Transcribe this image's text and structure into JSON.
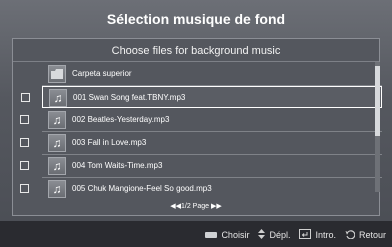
{
  "window": {
    "title": "Sélection musique de fond"
  },
  "panel": {
    "subtitle": "Choose files for background music",
    "folder_item": {
      "label": "Carpeta superior",
      "icon": "folder-icon"
    },
    "files": [
      {
        "label": "001 Swan Song feat.TBNY.mp3",
        "icon": "music-note-icon"
      },
      {
        "label": "002 Beatles-Yesterday.mp3",
        "icon": "music-note-icon"
      },
      {
        "label": "003 Fall in Love.mp3",
        "icon": "music-note-icon"
      },
      {
        "label": "004 Tom Waits-Time.mp3",
        "icon": "music-note-icon"
      },
      {
        "label": "005 Chuk Mangione-Feel So good.mp3",
        "icon": "music-note-icon"
      }
    ]
  },
  "pager": {
    "text": "◀◀1/2 Page ▶▶"
  },
  "help_bar": {
    "choose": "Choisir",
    "move": "Dépl.",
    "enter": "Intro.",
    "back": "Retour"
  }
}
